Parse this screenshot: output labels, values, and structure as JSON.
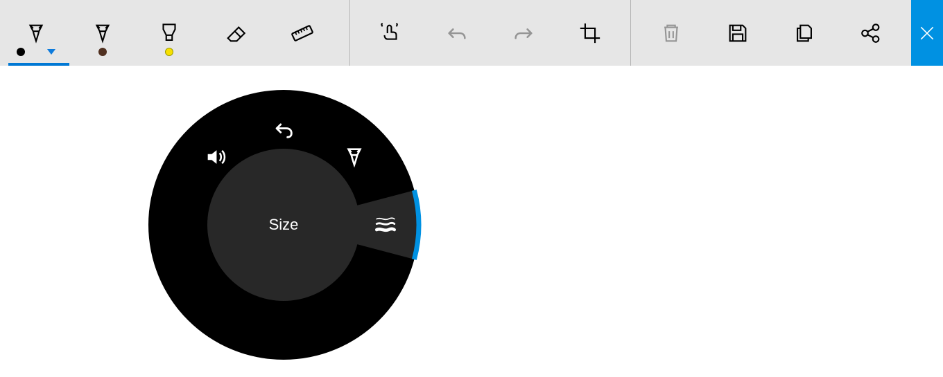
{
  "toolbar": {
    "pens": [
      {
        "name": "ballpoint-pen",
        "color_swatch": "#000000",
        "active": true,
        "has_dropdown": true
      },
      {
        "name": "pencil",
        "color_swatch": "#503020",
        "active": false,
        "has_dropdown": false
      },
      {
        "name": "highlighter",
        "color_swatch": "#f7e000",
        "active": false,
        "has_dropdown": false
      }
    ],
    "tools": [
      {
        "name": "eraser"
      },
      {
        "name": "ruler"
      }
    ],
    "section2": [
      {
        "name": "touch-writing"
      },
      {
        "name": "undo",
        "disabled": true
      },
      {
        "name": "redo",
        "disabled": true
      },
      {
        "name": "crop"
      }
    ],
    "section3": [
      {
        "name": "delete",
        "disabled": true
      },
      {
        "name": "save"
      },
      {
        "name": "copy"
      },
      {
        "name": "share"
      }
    ],
    "close_label": "Close"
  },
  "dial": {
    "center_label": "Size",
    "options": [
      {
        "name": "volume",
        "icon": "volume-icon"
      },
      {
        "name": "undo",
        "icon": "undo-icon"
      },
      {
        "name": "pen",
        "icon": "pen-icon"
      },
      {
        "name": "size",
        "icon": "size-icon",
        "selected": true
      }
    ],
    "accent_color": "#0091e2"
  }
}
